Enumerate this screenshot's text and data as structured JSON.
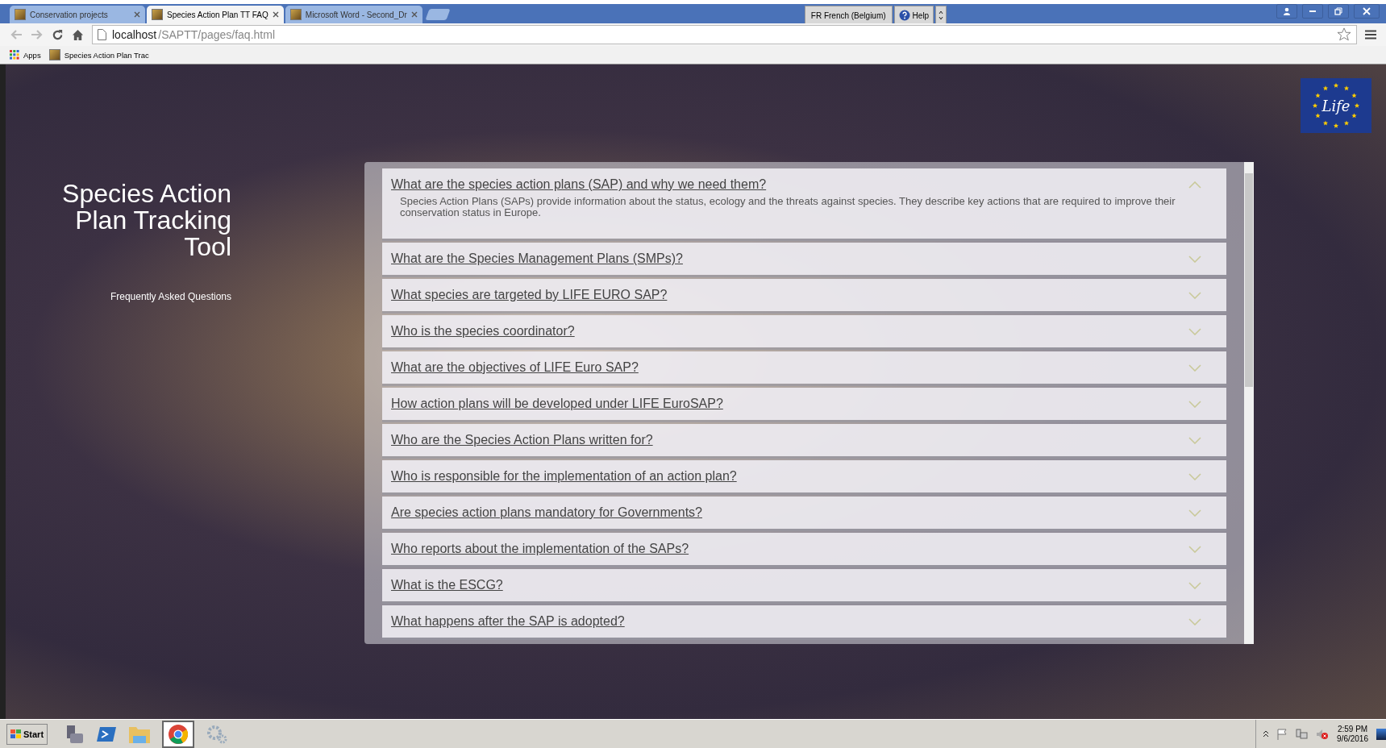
{
  "browser": {
    "tabs": [
      {
        "label": "Conservation projects",
        "selected": false
      },
      {
        "label": "Species Action Plan TT FAQ",
        "selected": true
      },
      {
        "label": "Microsoft Word - Second_Dr",
        "selected": false
      }
    ],
    "language": "FR French (Belgium)",
    "help": "Help",
    "address": {
      "host": "localhost",
      "path": "/SAPTT/pages/faq.html"
    },
    "bookmarks": [
      "Apps",
      "Species Action Plan Trac"
    ]
  },
  "page": {
    "title": "Species Action Plan Tracking Tool",
    "subtitle": "Frequently Asked Questions",
    "faq": [
      {
        "question": "What are the species action plans (SAP) and why we need them?",
        "expanded": true,
        "answer": "Species Action Plans (SAPs) provide information about the status, ecology and the threats against species. They describe key actions that are required to improve their conservation status in Europe."
      },
      {
        "question": "What are the Species Management Plans (SMPs)?",
        "expanded": false
      },
      {
        "question": "What species are targeted by LIFE EURO SAP?",
        "expanded": false
      },
      {
        "question": "Who is the species coordinator?",
        "expanded": false
      },
      {
        "question": "What are the objectives of LIFE Euro SAP?",
        "expanded": false
      },
      {
        "question": "How action plans will be developed under LIFE EuroSAP?",
        "expanded": false
      },
      {
        "question": "Who are the Species Action Plans written for?",
        "expanded": false
      },
      {
        "question": "Who is responsible for the implementation of an action plan?",
        "expanded": false
      },
      {
        "question": "Are species action plans mandatory for Governments?",
        "expanded": false
      },
      {
        "question": "Who reports about the implementation of the SAPs?",
        "expanded": false
      },
      {
        "question": "What is the ESCG?",
        "expanded": false
      },
      {
        "question": "What happens after the SAP is adopted?",
        "expanded": false
      }
    ]
  },
  "logo_text": "Life",
  "taskbar": {
    "start": "Start",
    "time": "2:59 PM",
    "date": "9/6/2016"
  }
}
